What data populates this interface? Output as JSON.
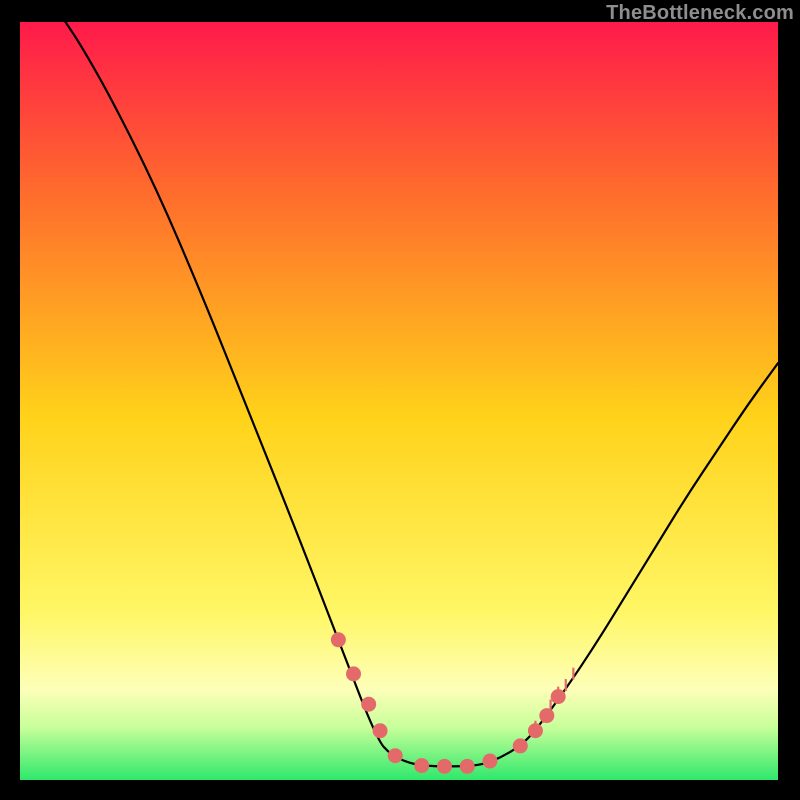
{
  "watermark": {
    "text": "TheBottleneck.com"
  },
  "colors": {
    "background": "#000000",
    "watermark": "#8e8e8e",
    "gradient_top": "#ff1a4b",
    "gradient_mid_upper": "#ff6a2d",
    "gradient_mid": "#ffd21a",
    "gradient_mid_lower": "#fff766",
    "gradient_bottom": "#2ee86b",
    "curve_stroke": "#000000",
    "marker_fill": "#e46a6a",
    "marker_tick": "#e46a6a"
  },
  "chart_data": {
    "type": "line",
    "title": "",
    "xlabel": "",
    "ylabel": "",
    "xlim": [
      0,
      100
    ],
    "ylim": [
      0,
      100
    ],
    "grid": false,
    "series": [
      {
        "name": "left-branch",
        "x": [
          6.0,
          8.0,
          12.0,
          18.0,
          24.0,
          30.0,
          36.0,
          42.0,
          47.0
        ],
        "y": [
          100.0,
          97.0,
          90.0,
          78.0,
          64.0,
          49.0,
          34.0,
          18.5,
          5.5
        ]
      },
      {
        "name": "valley",
        "x": [
          47.0,
          49.0,
          52.0,
          55.0,
          58.0,
          61.0,
          63.5,
          66.0,
          68.0
        ],
        "y": [
          5.5,
          3.2,
          2.0,
          1.8,
          1.8,
          2.0,
          3.0,
          4.5,
          6.5
        ]
      },
      {
        "name": "right-branch",
        "x": [
          68.0,
          72.0,
          76.0,
          80.0,
          84.0,
          88.0,
          92.0,
          96.0,
          100.0
        ],
        "y": [
          6.5,
          12.0,
          18.0,
          24.5,
          31.0,
          37.5,
          43.5,
          49.5,
          55.0
        ]
      }
    ],
    "markers": {
      "name": "highlighted-points",
      "comment": "dots near the valley and small vertical ticks on the right rise",
      "dots": {
        "x": [
          42.0,
          44.0,
          46.0,
          47.5,
          49.5,
          53.0,
          56.0,
          59.0,
          62.0,
          66.0,
          68.0,
          69.5,
          71.0
        ],
        "y": [
          18.5,
          14.0,
          10.0,
          6.5,
          3.2,
          1.9,
          1.8,
          1.8,
          2.5,
          4.5,
          6.5,
          8.5,
          11.0
        ]
      },
      "ticks": {
        "x": [
          68.0,
          69.0,
          70.0,
          71.0,
          72.0,
          73.0
        ],
        "y": [
          6.5,
          7.8,
          9.3,
          11.0,
          12.0,
          13.5
        ]
      }
    }
  }
}
